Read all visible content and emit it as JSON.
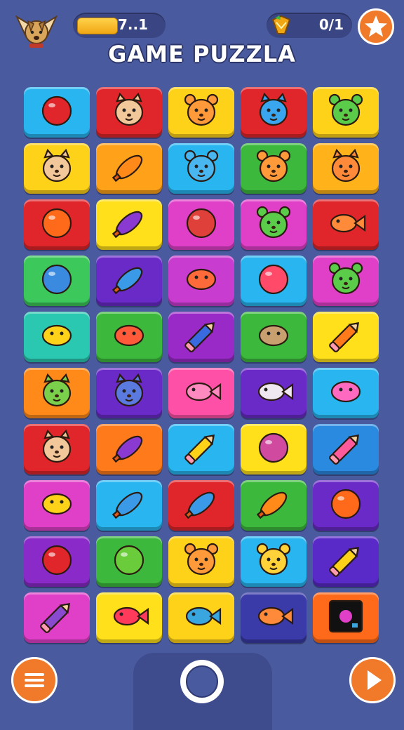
{
  "header": {
    "energy_value": "7..1",
    "gem_value": "0/1",
    "title": "GAME PUZZLA"
  },
  "icons": {
    "avatar": "winged-dog-avatar-icon",
    "gem": "gem-icon",
    "star": "star-icon",
    "menu": "hamburger-menu-icon",
    "center": "circle-button-icon",
    "play": "play-icon"
  },
  "colors": {
    "background": "#4a5a9e",
    "accent_orange": "#f07a2a",
    "energy": "#f0a613"
  },
  "grid": {
    "rows": [
      [
        {
          "bg": "#29b6f0",
          "icon": "apple"
        },
        {
          "bg": "#e0262a",
          "icon": "cat-face"
        },
        {
          "bg": "#ffd21a",
          "icon": "bear-face"
        },
        {
          "bg": "#e0262a",
          "icon": "cat-face-blue"
        },
        {
          "bg": "#ffd21a",
          "icon": "frog-face"
        }
      ],
      [
        {
          "bg": "#ffd21a",
          "icon": "cat-face"
        },
        {
          "bg": "#ffa21a",
          "icon": "carrot"
        },
        {
          "bg": "#29b6f0",
          "icon": "blue-creature"
        },
        {
          "bg": "#3cb83c",
          "icon": "bear-face"
        },
        {
          "bg": "#ffb21a",
          "icon": "fox-face"
        }
      ],
      [
        {
          "bg": "#e0262a",
          "icon": "balloon-orange"
        },
        {
          "bg": "#ffe01a",
          "icon": "eggplant"
        },
        {
          "bg": "#e040c8",
          "icon": "ornament"
        },
        {
          "bg": "#e040c8",
          "icon": "frog-face"
        },
        {
          "bg": "#e0262a",
          "icon": "fish-orange"
        }
      ],
      [
        {
          "bg": "#3cc85a",
          "icon": "racket"
        },
        {
          "bg": "#6a2ac8",
          "icon": "feather-blue"
        },
        {
          "bg": "#c83cd0",
          "icon": "parrot"
        },
        {
          "bg": "#29b6f0",
          "icon": "balloon-red"
        },
        {
          "bg": "#e040c8",
          "icon": "frog-face"
        }
      ],
      [
        {
          "bg": "#2ac8b0",
          "icon": "chick"
        },
        {
          "bg": "#3cb83c",
          "icon": "potato-red"
        },
        {
          "bg": "#9a2ac8",
          "icon": "pencil-blue"
        },
        {
          "bg": "#3cb83c",
          "icon": "mushroom-cap"
        },
        {
          "bg": "#ffe01a",
          "icon": "pencil-orange"
        }
      ],
      [
        {
          "bg": "#ff8a1a",
          "icon": "cat-green"
        },
        {
          "bg": "#6a2ac8",
          "icon": "cat-blue"
        },
        {
          "bg": "#ff50a8",
          "icon": "fish-pink"
        },
        {
          "bg": "#6a2ac8",
          "icon": "fish-white"
        },
        {
          "bg": "#29b6f0",
          "icon": "macaron"
        }
      ],
      [
        {
          "bg": "#e0262a",
          "icon": "cat-face"
        },
        {
          "bg": "#ff7a1a",
          "icon": "eggplant"
        },
        {
          "bg": "#29b6f0",
          "icon": "pencil-yellow"
        },
        {
          "bg": "#ffe01a",
          "icon": "berry-pink"
        },
        {
          "bg": "#2a8ae0",
          "icon": "pencil-pink"
        }
      ],
      [
        {
          "bg": "#e040c8",
          "icon": "chick"
        },
        {
          "bg": "#29b6f0",
          "icon": "feather-blue"
        },
        {
          "bg": "#e0262a",
          "icon": "feather-blue"
        },
        {
          "bg": "#3cb83c",
          "icon": "carrot"
        },
        {
          "bg": "#6a2ac8",
          "icon": "balloon-orange"
        }
      ],
      [
        {
          "bg": "#8a2ac8",
          "icon": "strawberry"
        },
        {
          "bg": "#3cb83c",
          "icon": "kiwi"
        },
        {
          "bg": "#ffd21a",
          "icon": "bear-face"
        },
        {
          "bg": "#29b6f0",
          "icon": "bear-yellow"
        },
        {
          "bg": "#5a2ac8",
          "icon": "pencil-yellow"
        }
      ],
      [
        {
          "bg": "#e040c8",
          "icon": "pencil-purple"
        },
        {
          "bg": "#ffe01a",
          "icon": "fish-red"
        },
        {
          "bg": "#ffd21a",
          "icon": "fish-blue"
        },
        {
          "bg": "#3a3aa8",
          "icon": "fish-orange"
        },
        {
          "bg": "#ff6a1a",
          "icon": "tv-box"
        }
      ]
    ]
  }
}
